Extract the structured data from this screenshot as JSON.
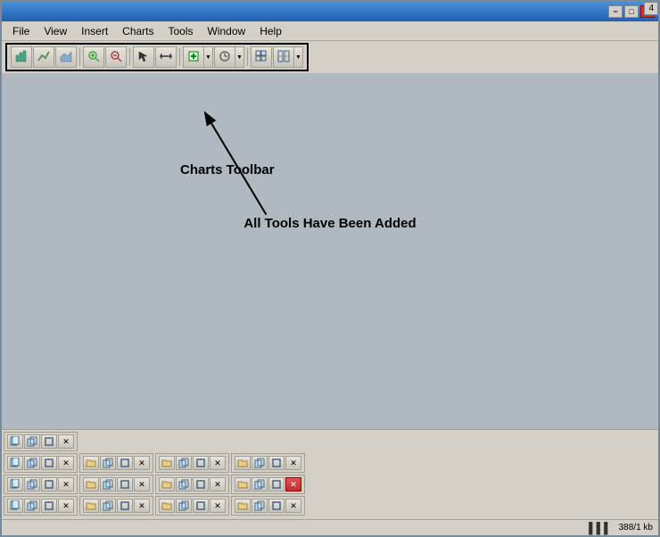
{
  "window": {
    "title": "",
    "title_btn_min": "−",
    "title_btn_max": "□",
    "title_btn_close": "✕"
  },
  "menu": {
    "items": [
      "File",
      "View",
      "Insert",
      "Charts",
      "Tools",
      "Window",
      "Help"
    ]
  },
  "toolbar": {
    "charts_toolbar_label": "Charts Toolbar",
    "all_tools_label": "All Tools Have Been Added",
    "buttons": [
      {
        "id": "bar",
        "icon": "bar-chart-icon",
        "class": "icon-bar-chart"
      },
      {
        "id": "line",
        "icon": "line-chart-icon",
        "class": "icon-line"
      },
      {
        "id": "area",
        "icon": "area-chart-icon",
        "class": "icon-area"
      },
      {
        "id": "zoom-in",
        "icon": "zoom-in-icon",
        "class": "icon-zoom-in"
      },
      {
        "id": "zoom-out",
        "icon": "zoom-out-icon",
        "class": "icon-zoom-out"
      },
      {
        "id": "cursor",
        "icon": "cursor-icon",
        "class": "icon-cursor"
      },
      {
        "id": "range",
        "icon": "range-icon",
        "class": "icon-range"
      },
      {
        "id": "insert",
        "icon": "insert-icon",
        "class": "icon-insert"
      },
      {
        "id": "time",
        "icon": "time-icon",
        "class": "icon-time"
      },
      {
        "id": "grid",
        "icon": "grid-icon",
        "class": "icon-grid"
      },
      {
        "id": "chart2",
        "icon": "chart2-icon",
        "class": "icon-chart2"
      }
    ]
  },
  "page_badge": "4",
  "status": {
    "bar_icon": "▌▌▌▌",
    "info": "388/1 kb"
  },
  "taskbar": {
    "row0": [
      {
        "type": "panel",
        "btns": [
          "doc",
          "copy",
          "sq",
          "x"
        ]
      }
    ],
    "row1": [
      {
        "type": "panel",
        "btns": [
          "doc",
          "copy",
          "sq",
          "x"
        ]
      },
      {
        "type": "panel",
        "btns": [
          "folder",
          "copy",
          "sq",
          "x"
        ]
      },
      {
        "type": "panel",
        "btns": [
          "folder",
          "copy",
          "sq",
          "x"
        ]
      },
      {
        "type": "panel",
        "btns": [
          "folder",
          "copy",
          "sq",
          "x"
        ]
      }
    ],
    "row2": [
      {
        "type": "panel",
        "btns": [
          "doc",
          "copy",
          "sq",
          "x"
        ]
      },
      {
        "type": "panel",
        "btns": [
          "folder",
          "copy",
          "sq",
          "x"
        ]
      },
      {
        "type": "panel",
        "btns": [
          "folder",
          "copy",
          "sq",
          "x"
        ]
      },
      {
        "type": "panel",
        "btns": [
          "folder",
          "copy",
          "sq",
          "x_red"
        ]
      }
    ],
    "row3": [
      {
        "type": "panel",
        "btns": [
          "doc",
          "copy",
          "sq",
          "x"
        ]
      },
      {
        "type": "panel",
        "btns": [
          "folder",
          "copy",
          "sq",
          "x"
        ]
      },
      {
        "type": "panel",
        "btns": [
          "folder",
          "copy",
          "sq",
          "x"
        ]
      },
      {
        "type": "panel",
        "btns": [
          "folder",
          "copy",
          "sq",
          "x"
        ]
      }
    ]
  }
}
